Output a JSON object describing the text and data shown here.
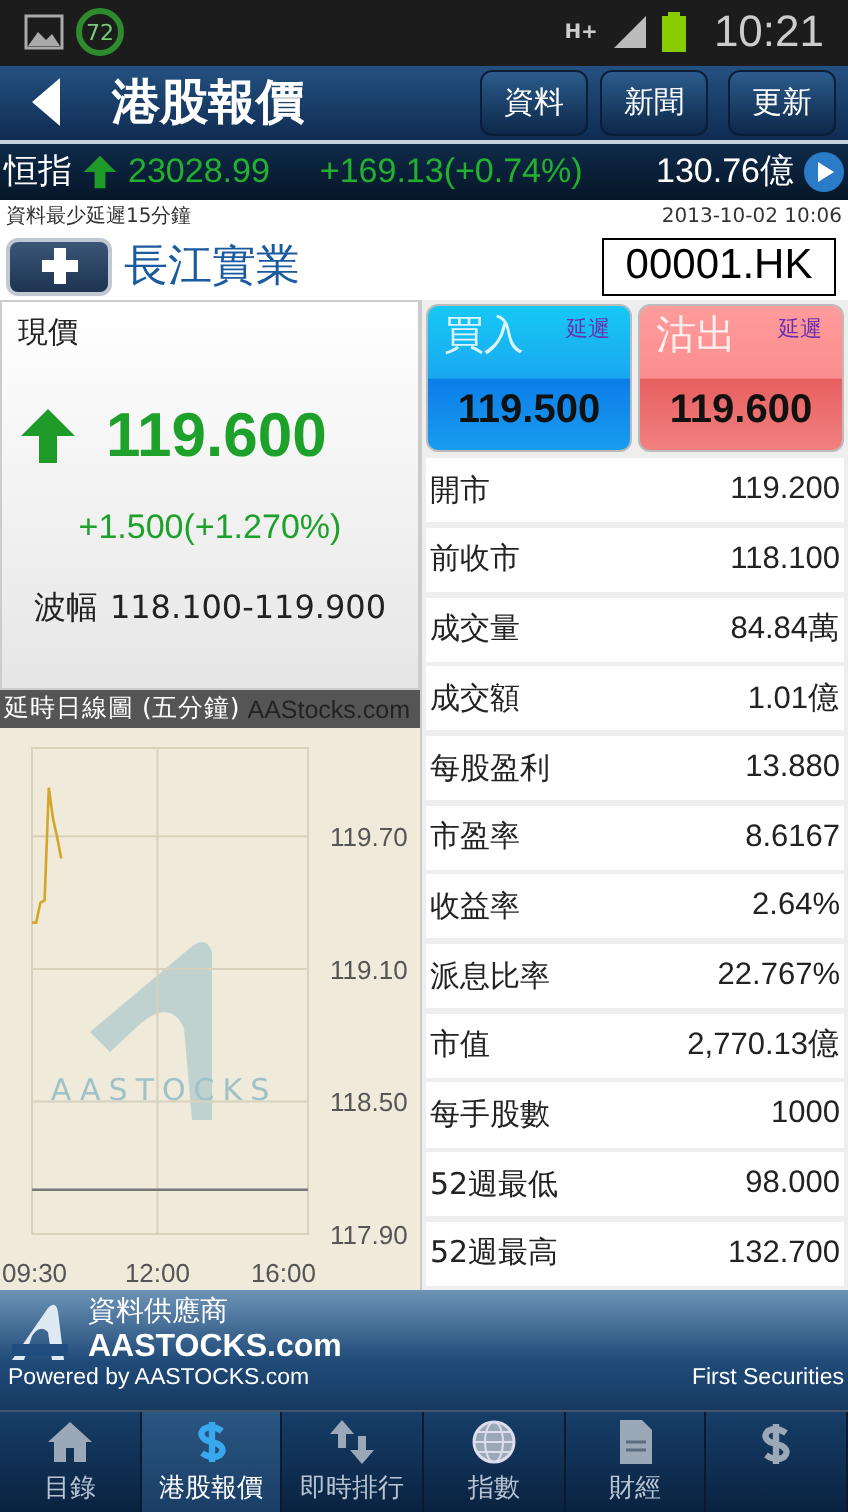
{
  "status_bar": {
    "badge": "72",
    "network": "H+",
    "time": "10:21"
  },
  "header": {
    "title": "港股報價",
    "buttons": [
      "資料",
      "新聞",
      "更新"
    ]
  },
  "index_ticker": {
    "name": "恒指",
    "rising": true,
    "value": "23028.99",
    "change": "+169.13(+0.74%)",
    "turnover": "130.76億"
  },
  "notice": "資料最少延遲15分鐘",
  "timestamp": "2013-10-02 10:06",
  "stock": {
    "name": "長江實業",
    "code": "00001.HK"
  },
  "quote": {
    "label": "現價",
    "rising": true,
    "price": "119.600",
    "change": "+1.500(+1.270%)",
    "range_label": "波幅",
    "range": "118.100-119.900"
  },
  "bid_ask": [
    {
      "kind": "bid",
      "caption": "買入",
      "tag": "延遲",
      "price": "119.500"
    },
    {
      "kind": "ask",
      "caption": "沽出",
      "tag": "延遲",
      "price": "119.600"
    }
  ],
  "stats": [
    {
      "label": "開市",
      "value": "119.200"
    },
    {
      "label": "前收市",
      "value": "118.100"
    },
    {
      "label": "成交量",
      "value": "84.84萬"
    },
    {
      "label": "成交額",
      "value": "1.01億"
    },
    {
      "label": "每股盈利",
      "value": "13.880"
    },
    {
      "label": "市盈率",
      "value": "8.6167"
    },
    {
      "label": "收益率",
      "value": "2.64%"
    },
    {
      "label": "派息比率",
      "value": "22.767%"
    },
    {
      "label": "市值",
      "value": "2,770.13億"
    },
    {
      "label": "每手股數",
      "value": "1000"
    },
    {
      "label": "52週最低",
      "value": "98.000"
    },
    {
      "label": "52週最高",
      "value": "132.700"
    }
  ],
  "chart": {
    "title": "延時日線圖 (五分鐘)",
    "source": "AAStocks.com",
    "watermark": "AASTOCKS",
    "chart_data": {
      "type": "line",
      "categories": [
        "09:30",
        null,
        null,
        null,
        null,
        null,
        null,
        null,
        null,
        null,
        null,
        null,
        null,
        null,
        null,
        null,
        null,
        null,
        null,
        null,
        null,
        null,
        null,
        null,
        null,
        null,
        null,
        null,
        null,
        null,
        "12:00",
        null,
        null,
        null,
        null,
        null,
        null,
        null,
        null,
        null,
        null,
        null,
        null,
        null,
        null,
        null,
        null,
        null,
        null,
        null,
        null,
        null,
        null,
        null,
        null,
        null,
        null,
        null,
        null,
        null,
        null,
        null,
        null,
        null,
        null,
        null,
        "16:00"
      ],
      "series": [
        {
          "color": "#d4a528",
          "values": [
            119.31,
            119.31,
            119.4,
            119.41,
            119.92,
            119.78,
            119.7,
            119.6,
            null,
            null,
            null,
            null,
            null,
            null,
            null,
            null,
            null,
            null,
            null,
            null,
            null,
            null,
            null,
            null,
            null,
            null,
            null,
            null,
            null,
            null,
            null,
            null,
            null,
            null,
            null,
            null,
            null,
            null,
            null,
            null,
            null,
            null,
            null,
            null,
            null,
            null,
            null,
            null,
            null,
            null,
            null,
            null,
            null,
            null,
            null,
            null,
            null,
            null,
            null,
            null,
            null,
            null,
            null,
            null,
            null,
            null,
            null
          ]
        },
        {
          "color": "#777777",
          "values": [
            118.1,
            118.1,
            118.1,
            118.1,
            118.1,
            118.1,
            118.1,
            118.1,
            118.1,
            118.1,
            118.1,
            118.1,
            118.1,
            118.1,
            118.1,
            118.1,
            118.1,
            118.1,
            118.1,
            118.1,
            118.1,
            118.1,
            118.1,
            118.1,
            118.1,
            118.1,
            118.1,
            118.1,
            118.1,
            118.1,
            118.1,
            118.1,
            118.1,
            118.1,
            118.1,
            118.1,
            118.1,
            118.1,
            118.1,
            118.1,
            118.1,
            118.1,
            118.1,
            118.1,
            118.1,
            118.1,
            118.1,
            118.1,
            118.1,
            118.1,
            118.1,
            118.1,
            118.1,
            118.1,
            118.1,
            118.1,
            118.1,
            118.1,
            118.1,
            118.1,
            118.1,
            118.1,
            118.1,
            118.1,
            118.1,
            118.1,
            118.1
          ]
        }
      ],
      "ylim": [
        117.9,
        120.1
      ],
      "yticks": [
        {
          "value": 117.9,
          "label": "117.90"
        },
        {
          "value": 118.5,
          "label": "118.50"
        },
        {
          "value": 119.1,
          "label": "119.10"
        },
        {
          "value": 119.7,
          "label": "119.70"
        }
      ],
      "grid": true
    }
  },
  "footer": {
    "provider_label": "資料供應商",
    "provider": "AASTOCKS.com",
    "powered_by": "Powered by AASTOCKS.com",
    "broker": "First Securities"
  },
  "tabs": [
    {
      "kind": "home",
      "label": "目錄",
      "selected": false
    },
    {
      "kind": "dollar",
      "label": "港股報價",
      "selected": true
    },
    {
      "kind": "updown",
      "label": "即時排行",
      "selected": false
    },
    {
      "kind": "globe",
      "label": "指數",
      "selected": false
    },
    {
      "kind": "document",
      "label": "財經",
      "selected": false
    },
    {
      "kind": "dollar",
      "selected": false
    }
  ]
}
